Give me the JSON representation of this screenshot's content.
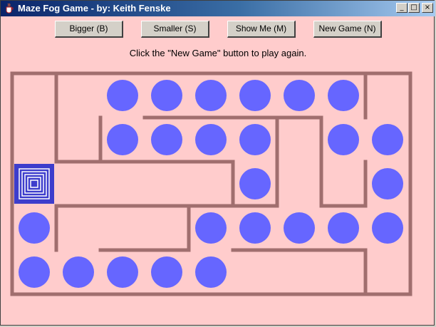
{
  "window": {
    "title": "Maze Fog Game - by: Keith Fenske",
    "controls": {
      "minimize": "_",
      "maximize": "□",
      "close": "×"
    }
  },
  "toolbar": {
    "bigger_label": "Bigger (B)",
    "smaller_label": "Smaller (S)",
    "show_me_label": "Show Me (M)",
    "new_game_label": "New Game (N)"
  },
  "status": {
    "message": "Click the \"New Game\" button to play again."
  },
  "maze": {
    "rows": 5,
    "cols": 9,
    "player": {
      "row": 2,
      "col": 0
    },
    "visited_dots": [
      {
        "row": 0,
        "col": 2
      },
      {
        "row": 0,
        "col": 3
      },
      {
        "row": 0,
        "col": 4
      },
      {
        "row": 0,
        "col": 5
      },
      {
        "row": 0,
        "col": 6
      },
      {
        "row": 0,
        "col": 7
      },
      {
        "row": 1,
        "col": 2
      },
      {
        "row": 1,
        "col": 3
      },
      {
        "row": 1,
        "col": 4
      },
      {
        "row": 1,
        "col": 5
      },
      {
        "row": 1,
        "col": 7
      },
      {
        "row": 1,
        "col": 8
      },
      {
        "row": 2,
        "col": 5
      },
      {
        "row": 2,
        "col": 8
      },
      {
        "row": 3,
        "col": 0
      },
      {
        "row": 3,
        "col": 4
      },
      {
        "row": 3,
        "col": 5
      },
      {
        "row": 3,
        "col": 6
      },
      {
        "row": 3,
        "col": 7
      },
      {
        "row": 3,
        "col": 8
      },
      {
        "row": 4,
        "col": 0
      },
      {
        "row": 4,
        "col": 1
      },
      {
        "row": 4,
        "col": 2
      },
      {
        "row": 4,
        "col": 3
      },
      {
        "row": 4,
        "col": 4
      }
    ],
    "colors": {
      "background": "#ffcccc",
      "wall": "#a06e6e",
      "dot": "#6666ff",
      "player_frame": "#3d3dcc"
    }
  }
}
